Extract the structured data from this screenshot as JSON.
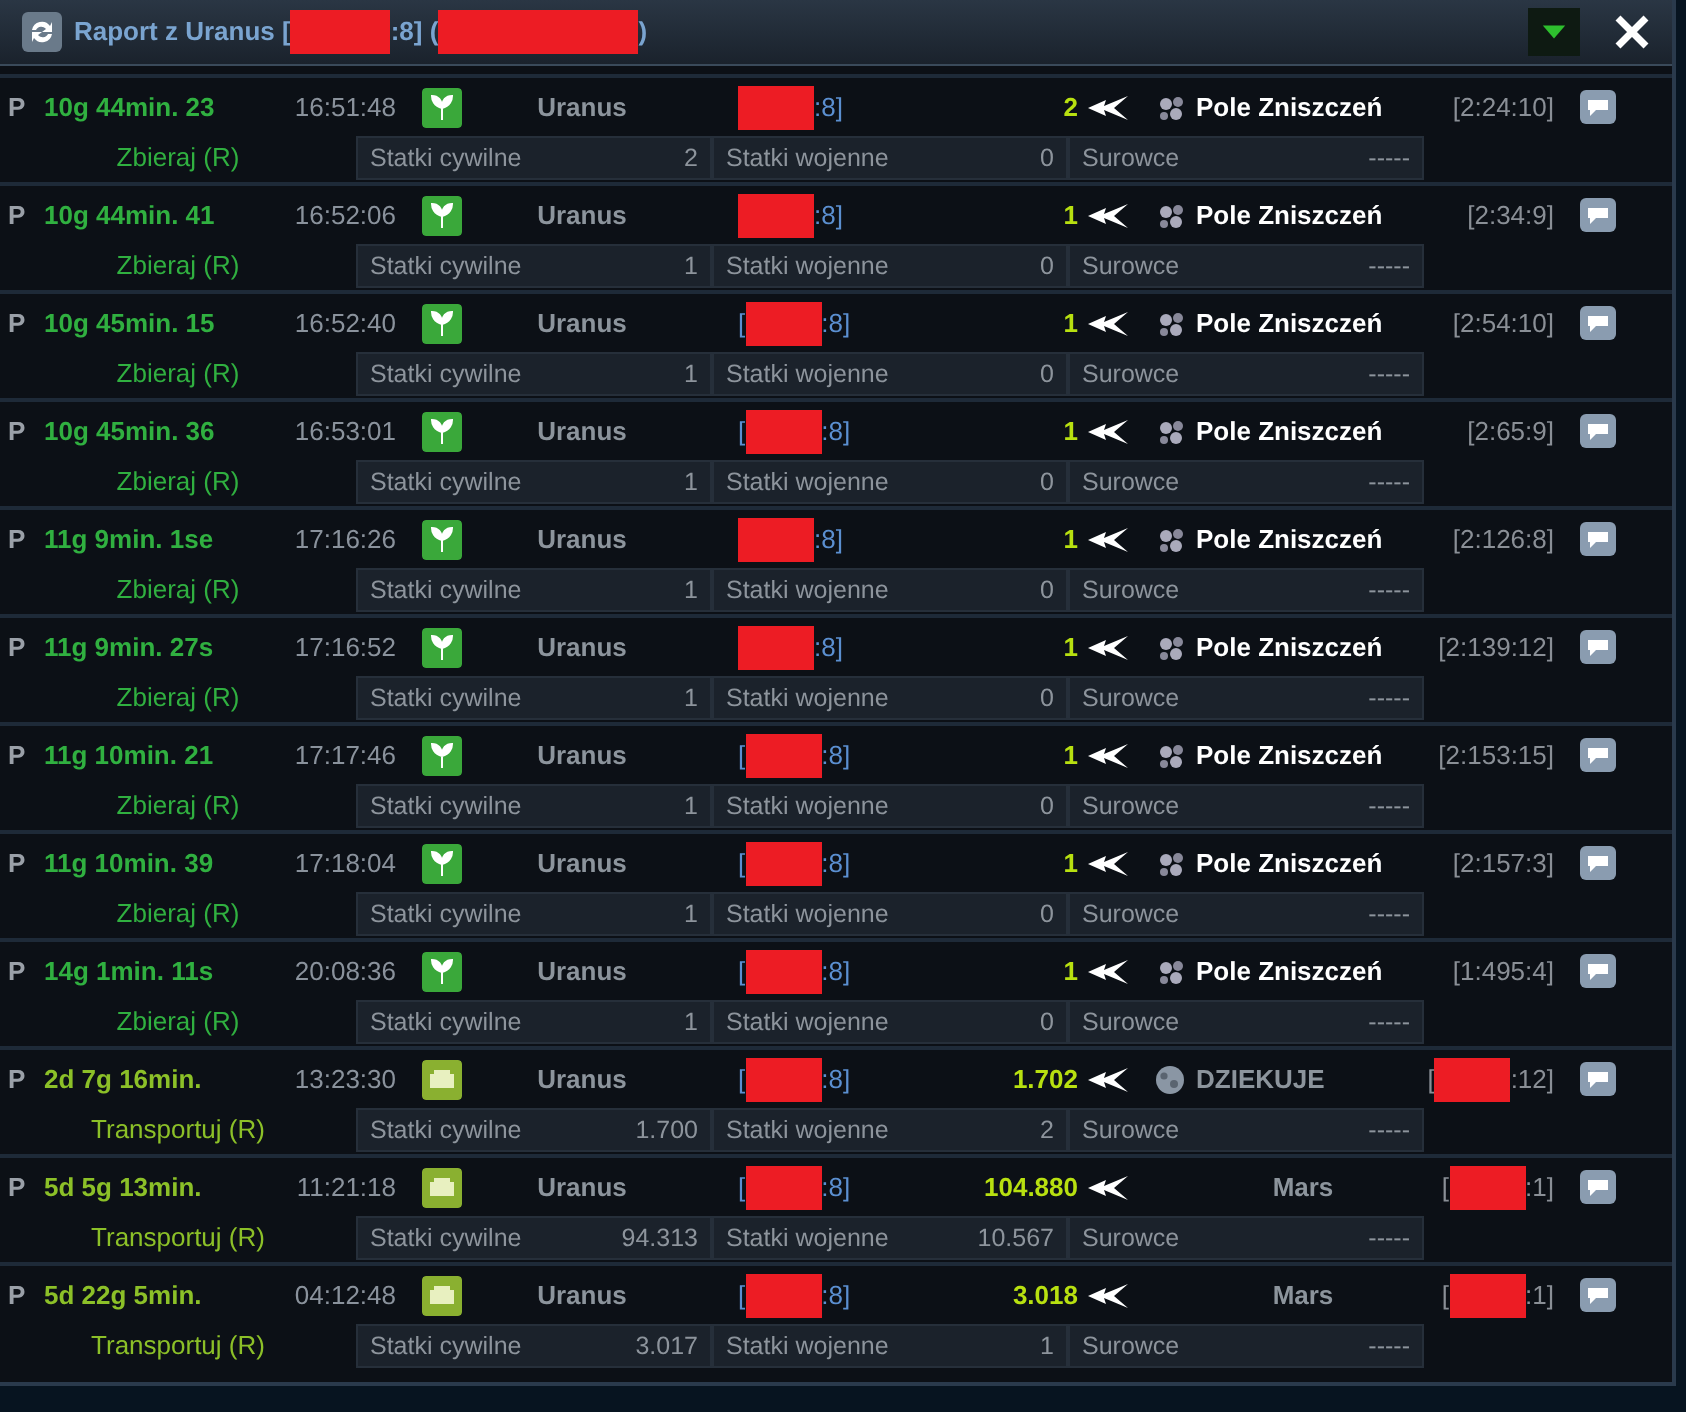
{
  "window": {
    "title_start": "Raport z Uranus [",
    "title_mid": ":8] (",
    "title_end": ")",
    "title_redacted": true
  },
  "rows": [
    {
      "kind": "collect",
      "flag": "P",
      "duration": "10g 44min. 23",
      "time": "16:51:48",
      "origin": "Uranus",
      "origin_coord": {
        "after": ":8]",
        "redacted": true
      },
      "count": "2",
      "dest": {
        "kind": "debris",
        "name": "Pole Zniszczeń",
        "coord": {
          "before": "[2:24:10]"
        }
      },
      "action": "Zbieraj (R)",
      "civil_label": "Statki cywilne",
      "civil": "2",
      "war_label": "Statki wojenne",
      "war": "0",
      "res_label": "Surowce",
      "res": "-----"
    },
    {
      "kind": "collect",
      "flag": "P",
      "duration": "10g 44min. 41",
      "time": "16:52:06",
      "origin": "Uranus",
      "origin_coord": {
        "after": ":8]",
        "redacted": true
      },
      "count": "1",
      "dest": {
        "kind": "debris",
        "name": "Pole Zniszczeń",
        "coord": {
          "before": "[2:34:9]"
        }
      },
      "action": "Zbieraj (R)",
      "civil_label": "Statki cywilne",
      "civil": "1",
      "war_label": "Statki wojenne",
      "war": "0",
      "res_label": "Surowce",
      "res": "-----"
    },
    {
      "kind": "collect",
      "flag": "P",
      "duration": "10g 45min. 15",
      "time": "16:52:40",
      "origin": "Uranus",
      "origin_coord": {
        "before": "[",
        "after": ":8]",
        "redacted": true
      },
      "count": "1",
      "dest": {
        "kind": "debris",
        "name": "Pole Zniszczeń",
        "coord": {
          "before": "[2:54:10]"
        }
      },
      "action": "Zbieraj (R)",
      "civil_label": "Statki cywilne",
      "civil": "1",
      "war_label": "Statki wojenne",
      "war": "0",
      "res_label": "Surowce",
      "res": "-----"
    },
    {
      "kind": "collect",
      "flag": "P",
      "duration": "10g 45min. 36",
      "time": "16:53:01",
      "origin": "Uranus",
      "origin_coord": {
        "before": "[",
        "after": ":8]",
        "redacted": true
      },
      "count": "1",
      "dest": {
        "kind": "debris",
        "name": "Pole Zniszczeń",
        "coord": {
          "before": "[2:65:9]"
        }
      },
      "action": "Zbieraj (R)",
      "civil_label": "Statki cywilne",
      "civil": "1",
      "war_label": "Statki wojenne",
      "war": "0",
      "res_label": "Surowce",
      "res": "-----"
    },
    {
      "kind": "collect",
      "flag": "P",
      "duration": "11g 9min. 1se",
      "time": "17:16:26",
      "origin": "Uranus",
      "origin_coord": {
        "after": ":8]",
        "redacted": true
      },
      "count": "1",
      "dest": {
        "kind": "debris",
        "name": "Pole Zniszczeń",
        "coord": {
          "before": "[2:126:8]"
        }
      },
      "action": "Zbieraj (R)",
      "civil_label": "Statki cywilne",
      "civil": "1",
      "war_label": "Statki wojenne",
      "war": "0",
      "res_label": "Surowce",
      "res": "-----"
    },
    {
      "kind": "collect",
      "flag": "P",
      "duration": "11g 9min. 27s",
      "time": "17:16:52",
      "origin": "Uranus",
      "origin_coord": {
        "after": ":8]",
        "redacted": true
      },
      "count": "1",
      "dest": {
        "kind": "debris",
        "name": "Pole Zniszczeń",
        "coord": {
          "before": "[2:139:12]"
        }
      },
      "action": "Zbieraj (R)",
      "civil_label": "Statki cywilne",
      "civil": "1",
      "war_label": "Statki wojenne",
      "war": "0",
      "res_label": "Surowce",
      "res": "-----"
    },
    {
      "kind": "collect",
      "flag": "P",
      "duration": "11g 10min. 21",
      "time": "17:17:46",
      "origin": "Uranus",
      "origin_coord": {
        "before": "[",
        "after": ":8]",
        "redacted": true
      },
      "count": "1",
      "dest": {
        "kind": "debris",
        "name": "Pole Zniszczeń",
        "coord": {
          "before": "[2:153:15]"
        }
      },
      "action": "Zbieraj (R)",
      "civil_label": "Statki cywilne",
      "civil": "1",
      "war_label": "Statki wojenne",
      "war": "0",
      "res_label": "Surowce",
      "res": "-----"
    },
    {
      "kind": "collect",
      "flag": "P",
      "duration": "11g 10min. 39",
      "time": "17:18:04",
      "origin": "Uranus",
      "origin_coord": {
        "before": "[",
        "after": ":8]",
        "redacted": true
      },
      "count": "1",
      "dest": {
        "kind": "debris",
        "name": "Pole Zniszczeń",
        "coord": {
          "before": "[2:157:3]"
        }
      },
      "action": "Zbieraj (R)",
      "civil_label": "Statki cywilne",
      "civil": "1",
      "war_label": "Statki wojenne",
      "war": "0",
      "res_label": "Surowce",
      "res": "-----"
    },
    {
      "kind": "collect",
      "flag": "P",
      "duration": "14g 1min. 11s",
      "time": "20:08:36",
      "origin": "Uranus",
      "origin_coord": {
        "before": "[",
        "after": ":8]",
        "redacted": true
      },
      "count": "1",
      "dest": {
        "kind": "debris",
        "name": "Pole Zniszczeń",
        "coord": {
          "before": "[1:495:4]"
        }
      },
      "action": "Zbieraj (R)",
      "civil_label": "Statki cywilne",
      "civil": "1",
      "war_label": "Statki wojenne",
      "war": "0",
      "res_label": "Surowce",
      "res": "-----"
    },
    {
      "kind": "transport",
      "flag": "P",
      "duration": "2d 7g 16min.",
      "time": "13:23:30",
      "origin": "Uranus",
      "origin_coord": {
        "before": "[",
        "after": ":8]",
        "redacted": true
      },
      "count": "1.702",
      "dest": {
        "kind": "planet",
        "name": "DZIEKUJE",
        "coord": {
          "before": "[",
          "after": ":12]",
          "redacted": true
        }
      },
      "action": "Transportuj (R)",
      "civil_label": "Statki cywilne",
      "civil": "1.700",
      "war_label": "Statki wojenne",
      "war": "2",
      "res_label": "Surowce",
      "res": "-----"
    },
    {
      "kind": "transport",
      "flag": "P",
      "duration": "5d 5g 13min.",
      "time": "11:21:18",
      "origin": "Uranus",
      "origin_coord": {
        "before": "[",
        "after": ":8]",
        "redacted": true
      },
      "count": "104.880",
      "dest": {
        "kind": "plain",
        "name": "Mars",
        "coord": {
          "before": "[",
          "after": ":1]",
          "redacted": true
        }
      },
      "action": "Transportuj (R)",
      "civil_label": "Statki cywilne",
      "civil": "94.313",
      "war_label": "Statki wojenne",
      "war": "10.567",
      "res_label": "Surowce",
      "res": "-----"
    },
    {
      "kind": "transport",
      "flag": "P",
      "duration": "5d 22g 5min.",
      "time": "04:12:48",
      "origin": "Uranus",
      "origin_coord": {
        "before": "[",
        "after": ":8]",
        "redacted": true
      },
      "count": "3.018",
      "dest": {
        "kind": "plain",
        "name": "Mars",
        "coord": {
          "before": "[",
          "after": ":1]",
          "redacted": true
        }
      },
      "action": "Transportuj (R)",
      "civil_label": "Statki cywilne",
      "civil": "3.017",
      "war_label": "Statki wojenne",
      "war": "1",
      "res_label": "Surowce",
      "res": "-----"
    }
  ]
}
